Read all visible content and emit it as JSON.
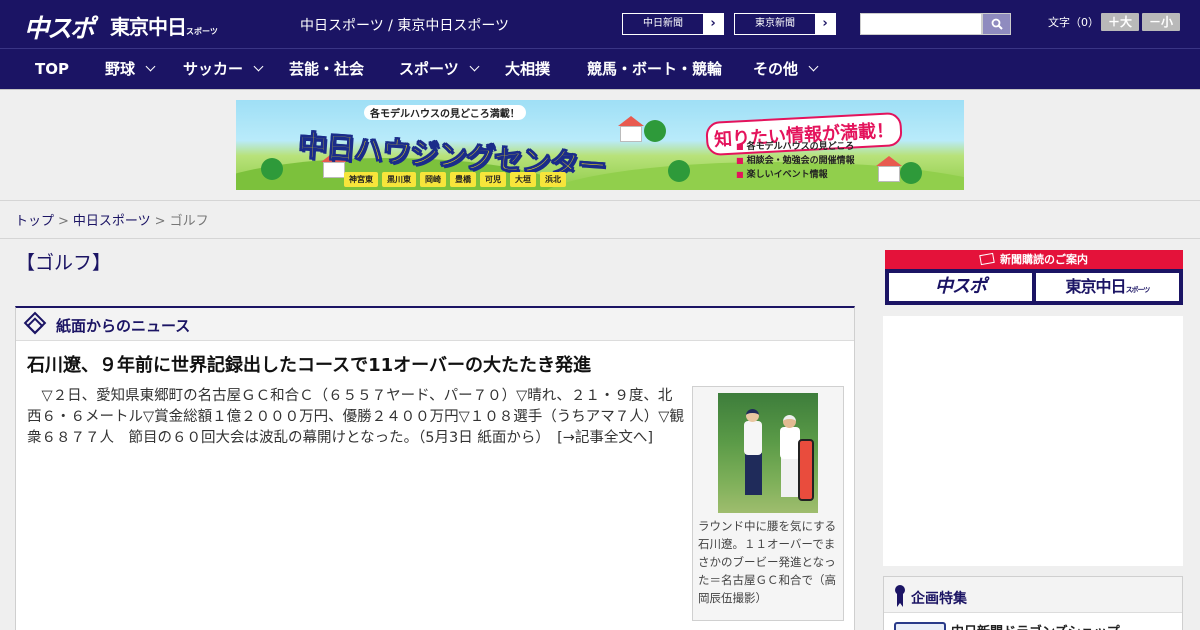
{
  "header": {
    "logo_chusupo": "中スポ",
    "logo_tokyo": "東京中日",
    "logo_tokyo_small": "スポーツ",
    "site_title": "中日スポーツ / 東京中日スポーツ",
    "link_chunichi": "中日新聞",
    "link_tokyo": "東京新聞",
    "link_arrow": "›",
    "search_placeholder": "",
    "font_size_label": "文字（0）",
    "font_bigger": "＋大",
    "font_smaller": "－小"
  },
  "nav": {
    "items": [
      {
        "label": "TOP",
        "has_dropdown": false
      },
      {
        "label": "野球",
        "has_dropdown": true
      },
      {
        "label": "サッカー",
        "has_dropdown": true
      },
      {
        "label": "芸能・社会",
        "has_dropdown": false
      },
      {
        "label": "スポーツ",
        "has_dropdown": true
      },
      {
        "label": "大相撲",
        "has_dropdown": false
      },
      {
        "label": "競馬・ボート・競輪",
        "has_dropdown": false
      },
      {
        "label": "その他",
        "has_dropdown": true
      }
    ]
  },
  "banner": {
    "top_text": "各モデルハウスの見どころ満載！",
    "main_text": "中日ハウジングセンター",
    "right_text": "知りたい情報が満載！",
    "list": [
      "各モデルハウスの見どころ",
      "相談会・勉強会の開催情報",
      "楽しいイベント情報"
    ],
    "towns": [
      "神宮東",
      "黒川東",
      "岡崎",
      "豊橋",
      "可児",
      "大垣",
      "浜北"
    ]
  },
  "breadcrumb": {
    "items": [
      "トップ",
      "中日スポーツ",
      "ゴルフ"
    ],
    "separator": ">"
  },
  "page_title": "【ゴルフ】",
  "news_panel": {
    "section_title": "紙面からのニュース",
    "headline": "石川遼、９年前に世界記録出したコースで11オーバーの大たたき発進",
    "body": "　▽２日、愛知県東郷町の名古屋ＧＣ和合Ｃ（６５５７ヤード、パー７０）▽晴れ、２１・９度、北西６・６メートル▽賞金総額１億２０００万円、優勝２４００万円▽１０８選手（うちアマ７人）▽観衆６８７７人　節目の６０回大会は波乱の幕開けとなった。（5月3日 紙面から）",
    "more_link": "　[→記事全文へ]",
    "photo_caption": "ラウンド中に腰を気にする石川遼。１１オーバーでまさかのブービー発進となった＝名古屋ＧＣ和合で（高岡辰伍撮影）"
  },
  "sidebar": {
    "subscribe_title": "新聞購読のご案内",
    "subscribe_logo_1": "中スポ",
    "subscribe_logo_2": "東京中日",
    "subscribe_logo_2_small": "スポーツ",
    "feature_title": "企画特集",
    "feature_item": "中日新聞ドラゴンズショップ"
  },
  "colors": {
    "brand_navy": "#1b1464",
    "accent_red": "#e4123a",
    "background": "#efefef"
  }
}
